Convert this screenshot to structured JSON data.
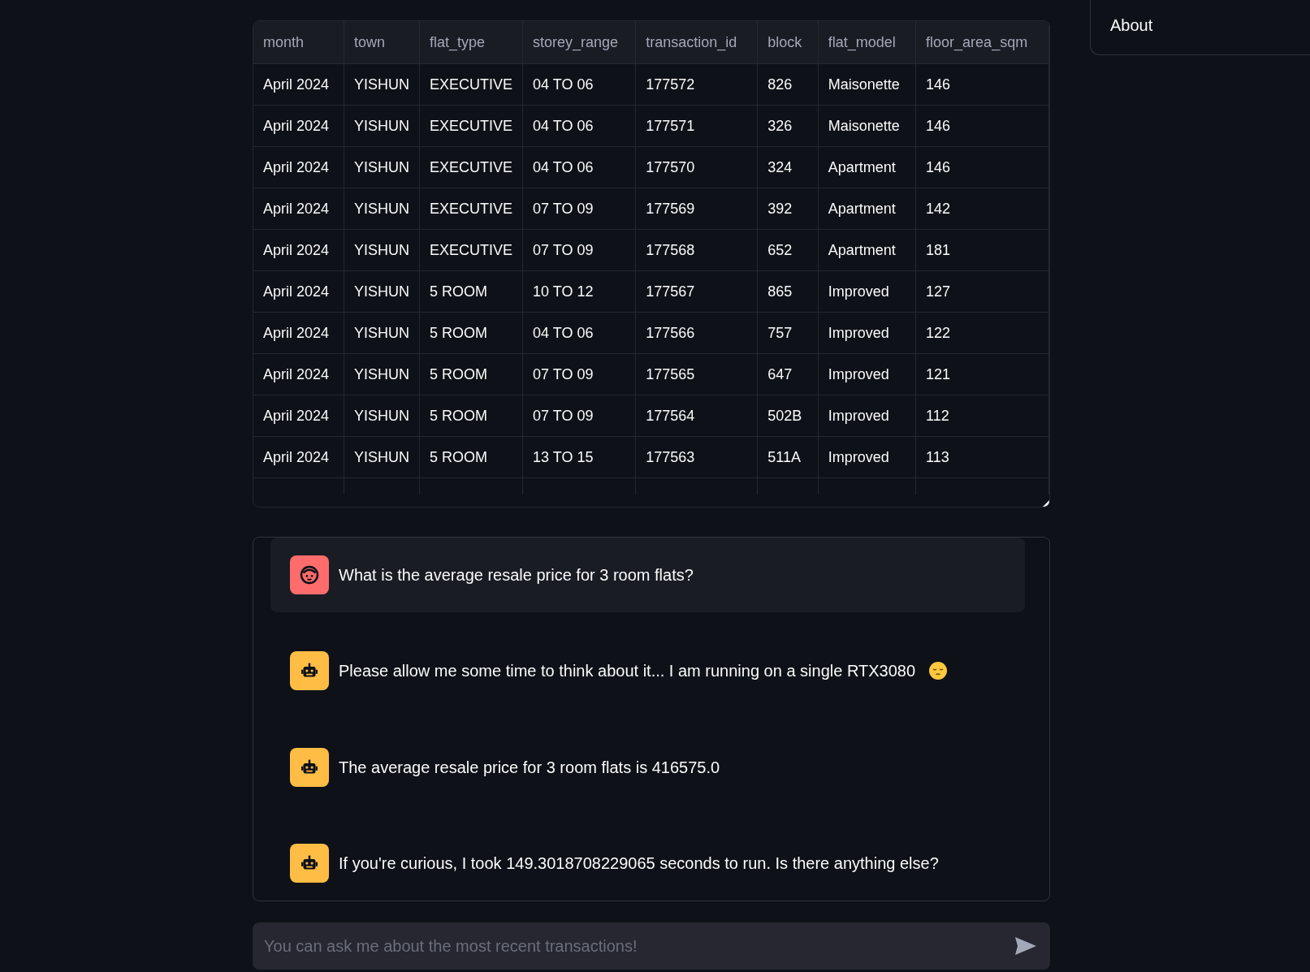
{
  "table": {
    "columns": [
      "month",
      "town",
      "flat_type",
      "storey_range",
      "transaction_id",
      "block",
      "flat_model",
      "floor_area_sqm"
    ],
    "rows": [
      [
        "April 2024",
        "YISHUN",
        "EXECUTIVE",
        "04 TO 06",
        "177572",
        "826",
        "Maisonette",
        "146"
      ],
      [
        "April 2024",
        "YISHUN",
        "EXECUTIVE",
        "04 TO 06",
        "177571",
        "326",
        "Maisonette",
        "146"
      ],
      [
        "April 2024",
        "YISHUN",
        "EXECUTIVE",
        "04 TO 06",
        "177570",
        "324",
        "Apartment",
        "146"
      ],
      [
        "April 2024",
        "YISHUN",
        "EXECUTIVE",
        "07 TO 09",
        "177569",
        "392",
        "Apartment",
        "142"
      ],
      [
        "April 2024",
        "YISHUN",
        "EXECUTIVE",
        "07 TO 09",
        "177568",
        "652",
        "Apartment",
        "181"
      ],
      [
        "April 2024",
        "YISHUN",
        "5 ROOM",
        "10 TO 12",
        "177567",
        "865",
        "Improved",
        "127"
      ],
      [
        "April 2024",
        "YISHUN",
        "5 ROOM",
        "04 TO 06",
        "177566",
        "757",
        "Improved",
        "122"
      ],
      [
        "April 2024",
        "YISHUN",
        "5 ROOM",
        "07 TO 09",
        "177565",
        "647",
        "Improved",
        "121"
      ],
      [
        "April 2024",
        "YISHUN",
        "5 ROOM",
        "07 TO 09",
        "177564",
        "502B",
        "Improved",
        "112"
      ],
      [
        "April 2024",
        "YISHUN",
        "5 ROOM",
        "13 TO 15",
        "177563",
        "511A",
        "Improved",
        "113"
      ]
    ]
  },
  "chat": {
    "messages": [
      {
        "kind": "user",
        "text": "What is the average resale price for 3 room flats?",
        "emoji": false
      },
      {
        "kind": "assistant",
        "text": "Please allow me some time to think about it... I am running on a single RTX3080",
        "emoji": true
      },
      {
        "kind": "assistant",
        "text": "The average resale price for 3 room flats is 416575.0",
        "emoji": false
      },
      {
        "kind": "assistant",
        "text": "If you're curious, I took 149.3018708229065 seconds to run. Is there anything else?",
        "emoji": false
      }
    ]
  },
  "chat_input": {
    "placeholder": "You can ask me about the most recent transactions!"
  },
  "sidebar": {
    "title": "About"
  }
}
